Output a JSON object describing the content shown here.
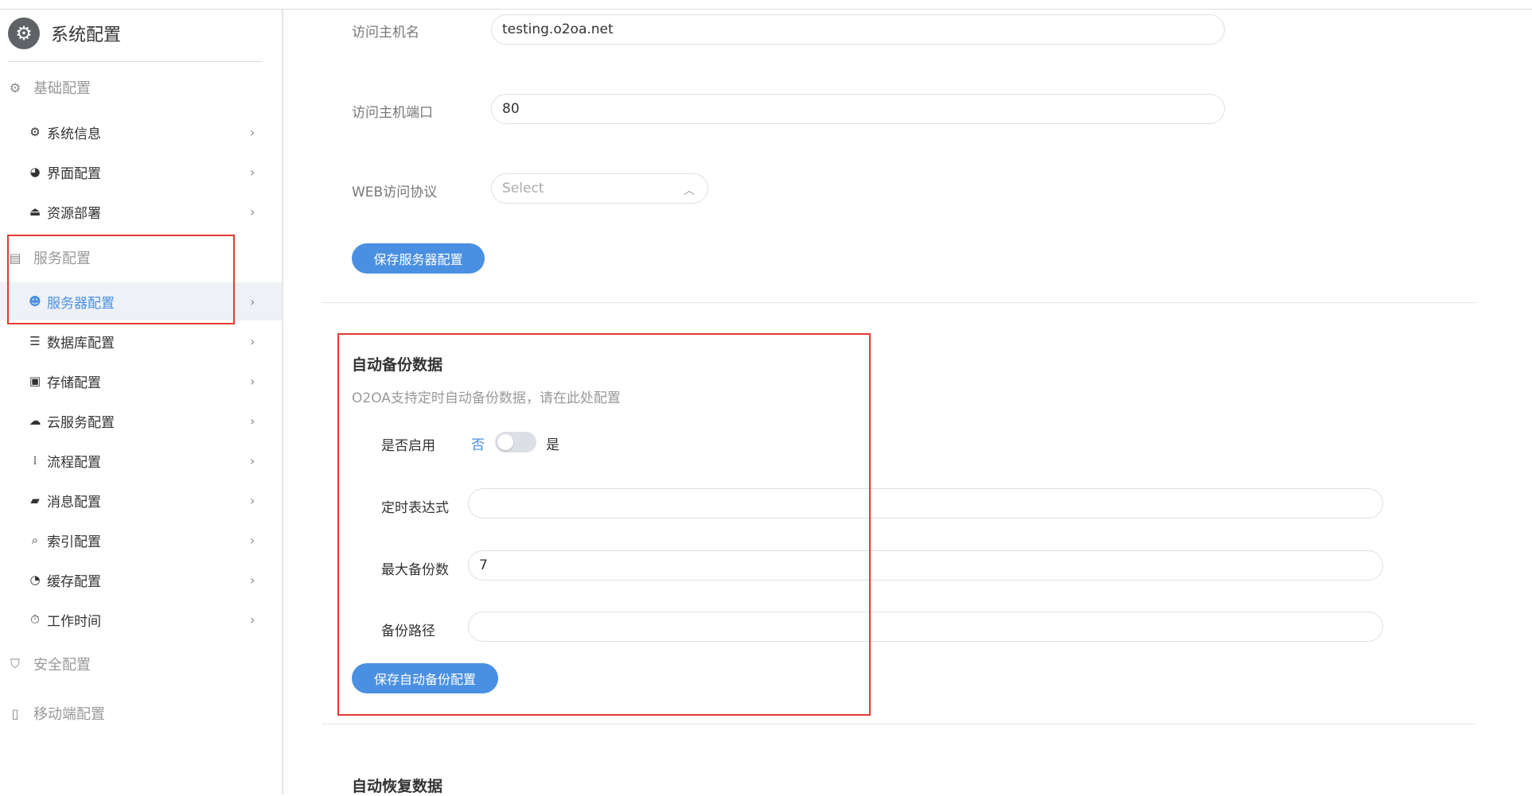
{
  "app": {
    "title": "系统配置",
    "logo_icon": "gear-icon"
  },
  "sidebar": {
    "groups": {
      "basic": {
        "label": "基础配置",
        "icon": "gear-icon"
      },
      "service": {
        "label": "服务配置",
        "icon": "server-icon"
      },
      "security": {
        "label": "安全配置",
        "icon": "shield-icon"
      },
      "mobile": {
        "label": "移动端配置",
        "icon": "mobile-icon"
      }
    },
    "items": {
      "system_info": {
        "label": "系统信息",
        "icon": "gear-icon"
      },
      "ui_config": {
        "label": "界面配置",
        "icon": "palette-icon"
      },
      "resource_deploy": {
        "label": "资源部署",
        "icon": "upload-icon"
      },
      "server_config": {
        "label": "服务器配置",
        "icon": "server-user-icon",
        "active": true
      },
      "database_config": {
        "label": "数据库配置",
        "icon": "database-icon"
      },
      "storage_config": {
        "label": "存储配置",
        "icon": "archive-icon"
      },
      "cloud_config": {
        "label": "云服务配置",
        "icon": "cloud-icon"
      },
      "process_config": {
        "label": "流程配置",
        "icon": "flow-icon"
      },
      "message_config": {
        "label": "消息配置",
        "icon": "message-icon"
      },
      "index_config": {
        "label": "索引配置",
        "icon": "search-icon"
      },
      "cache_config": {
        "label": "缓存配置",
        "icon": "pie-icon"
      },
      "work_time": {
        "label": "工作时间",
        "icon": "stopwatch-icon"
      }
    }
  },
  "server": {
    "host_label": "访问主机名",
    "host_value": "testing.o2oa.net",
    "port_label": "访问主机端口",
    "port_value": "80",
    "protocol_label": "WEB访问协议",
    "protocol_placeholder": "Select",
    "save_label": "保存服务器配置"
  },
  "backup": {
    "title": "自动备份数据",
    "description": "O2OA支持定时自动备份数据，请在此处配置",
    "enable_label": "是否启用",
    "toggle_off": "否",
    "toggle_on": "是",
    "enabled": false,
    "cron_label": "定时表达式",
    "cron_value": "",
    "max_label": "最大备份数",
    "max_value": "7",
    "path_label": "备份路径",
    "path_value": "",
    "save_label": "保存自动备份配置"
  },
  "restore": {
    "title": "自动恢复数据"
  },
  "colors": {
    "accent": "#4a90e2",
    "highlight": "#e53935",
    "active_bg": "#eef1f6"
  }
}
